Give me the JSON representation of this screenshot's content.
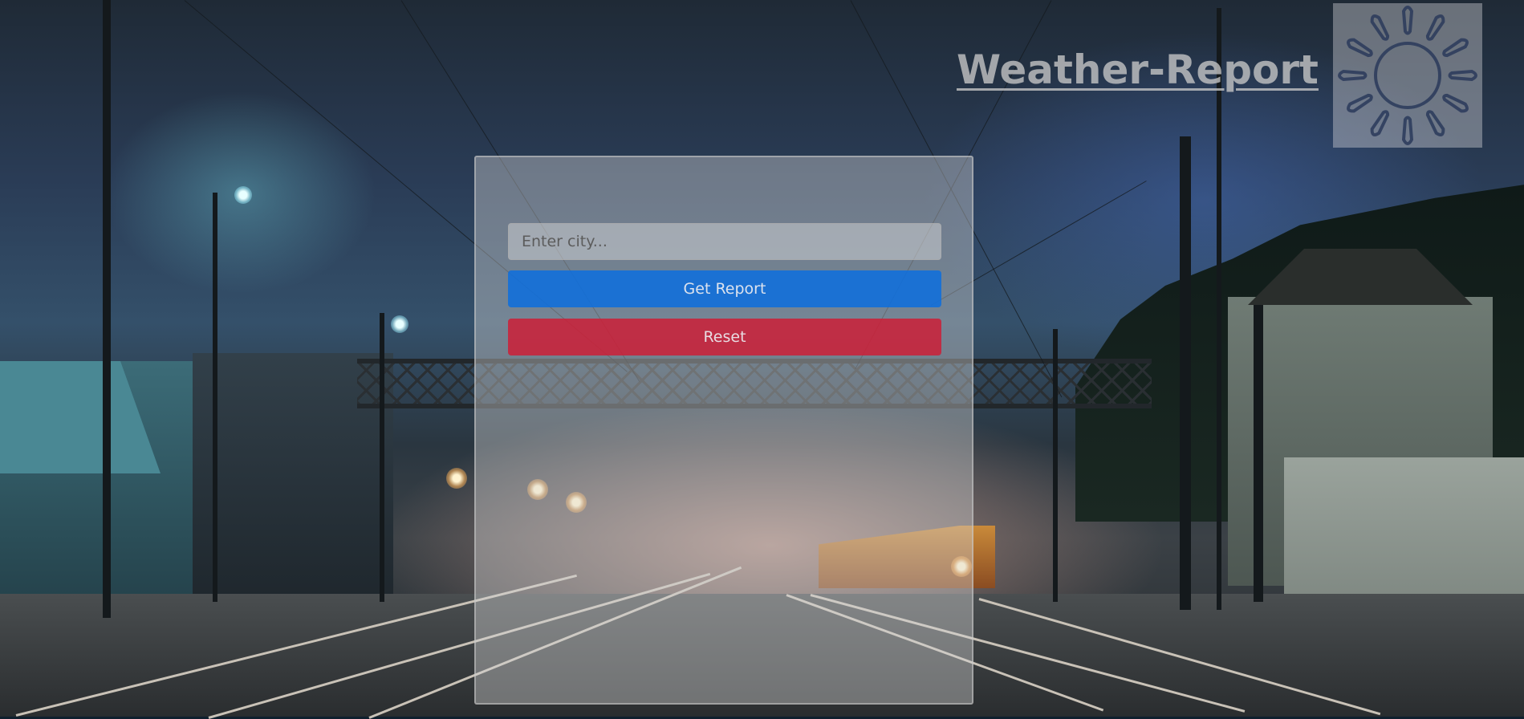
{
  "header": {
    "title": "Weather-Report",
    "logo_icon": "sun-icon"
  },
  "form": {
    "city_input": {
      "placeholder": "Enter city...",
      "value": ""
    },
    "get_report_label": "Get Report",
    "reset_label": "Reset"
  },
  "colors": {
    "get_report_button": "#1366d6",
    "reset_button": "#c8233f",
    "title_text": "#c8c8c8",
    "logo_stroke": "#2a3a5a"
  }
}
